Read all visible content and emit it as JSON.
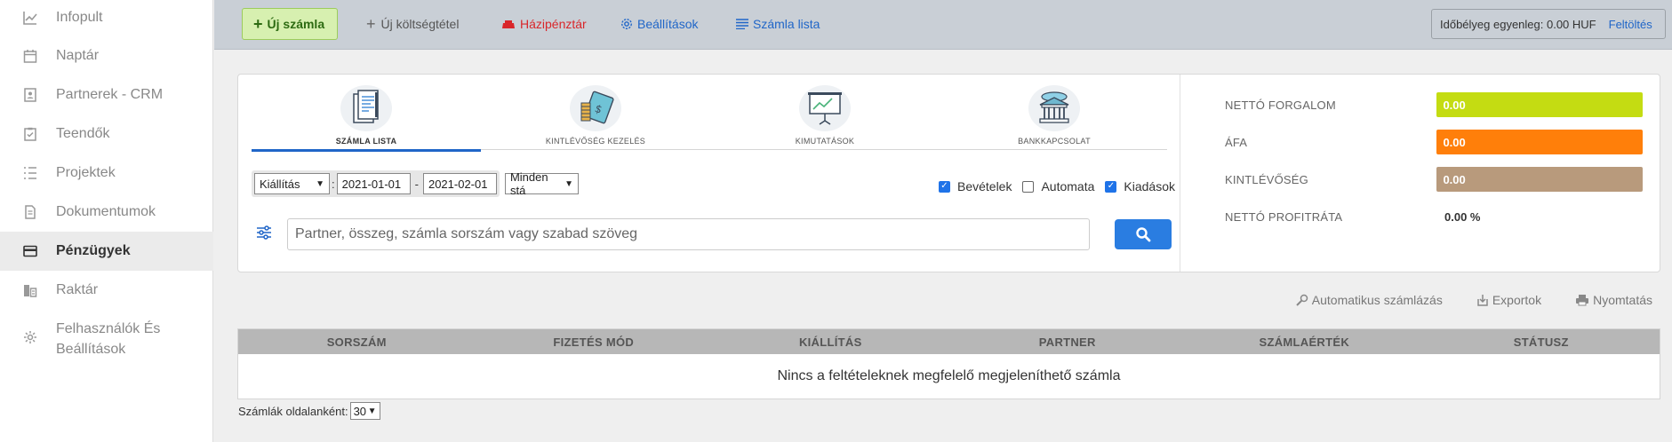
{
  "sidebar": {
    "items": [
      {
        "label": "Infopult",
        "icon": "chart-icon"
      },
      {
        "label": "Naptár",
        "icon": "calendar-icon"
      },
      {
        "label": "Partnerek - CRM",
        "icon": "contacts-icon"
      },
      {
        "label": "Teendők",
        "icon": "checklist-icon"
      },
      {
        "label": "Projektek",
        "icon": "list-icon"
      },
      {
        "label": "Dokumentumok",
        "icon": "document-icon"
      },
      {
        "label": "Pénzügyek",
        "icon": "credit-card-icon",
        "active": true
      },
      {
        "label": "Raktár",
        "icon": "warehouse-icon"
      },
      {
        "label_line1": "Felhasználók És",
        "label_line2": "Beállítások",
        "icon": "gear-icon"
      }
    ]
  },
  "toolbar": {
    "new_invoice": "Új számla",
    "new_cost": "Új költségtétel",
    "cash_register": "Házipénztár",
    "settings": "Beállítások",
    "invoice_list": "Számla lista",
    "stamp_balance": "Időbélyeg egyenleg: 0.00 HUF",
    "top_up": "Feltöltés"
  },
  "tabs": [
    {
      "label": "SZÁMLA LISTA",
      "icon": "invoice-document-icon",
      "active": true
    },
    {
      "label": "KINTLÉVŐSÉG KEZELÉS",
      "icon": "money-coins-icon"
    },
    {
      "label": "KIMUTATÁSOK",
      "icon": "presentation-chart-icon"
    },
    {
      "label": "BANKKAPCSOLAT",
      "icon": "bank-icon"
    }
  ],
  "filters": {
    "date_type": "Kiállítás",
    "date_from": "2021-01-01",
    "date_sep": "-",
    "date_to": "2021-02-01",
    "status": "Minden stá",
    "colon": ":"
  },
  "checkboxes": {
    "income": {
      "label": "Bevételek",
      "checked": true
    },
    "automatic": {
      "label": "Automata",
      "checked": false
    },
    "expenses": {
      "label": "Kiadások",
      "checked": true
    }
  },
  "search": {
    "placeholder": "Partner, összeg, számla sorszám vagy szabad szöveg"
  },
  "stats": {
    "net_turnover": {
      "label": "NETTÓ FORGALOM",
      "value": "0.00",
      "color": "#c4dc12"
    },
    "vat": {
      "label": "ÁFA",
      "value": "0.00",
      "color": "#ff7f0a"
    },
    "receivables": {
      "label": "KINTLÉVŐSÉG",
      "value": "0.00",
      "color": "#b89a7c"
    },
    "net_profit_rate": {
      "label": "NETTÓ PROFITRÁTA",
      "value": "0.00 %"
    }
  },
  "actions": {
    "auto_invoicing": "Automatikus számlázás",
    "exports": "Exportok",
    "print": "Nyomtatás"
  },
  "table": {
    "columns": [
      "SORSZÁM",
      "FIZETÉS MÓD",
      "KIÁLLÍTÁS",
      "PARTNER",
      "SZÁMLAÉRTÉK",
      "STÁTUSZ"
    ],
    "empty_message": "Nincs a feltételeknek megfelelő megjeleníthető számla"
  },
  "pagination": {
    "label": "Számlák oldalanként:",
    "per_page": "30"
  }
}
